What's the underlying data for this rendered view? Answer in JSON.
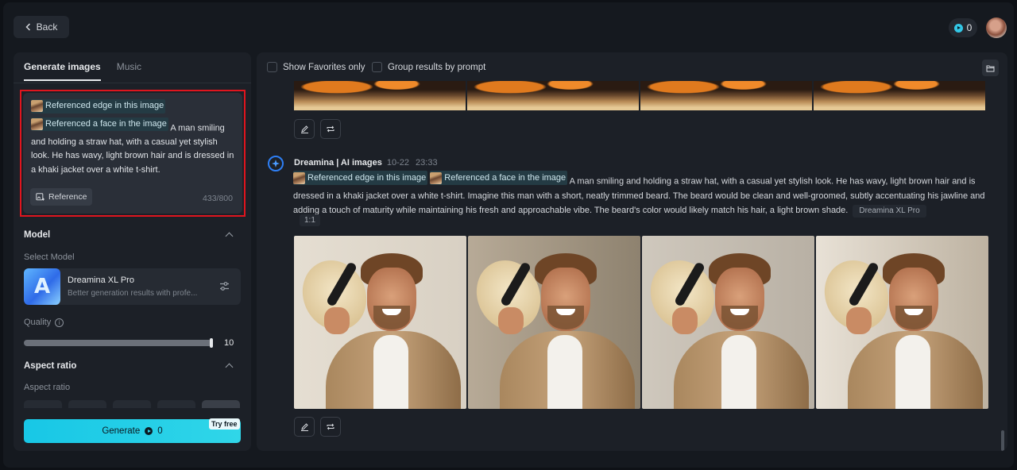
{
  "topbar": {
    "back_label": "Back",
    "credits": "0"
  },
  "left": {
    "tabs": [
      {
        "label": "Generate images",
        "active": true
      },
      {
        "label": "Music",
        "active": false
      }
    ],
    "prompt": {
      "ref1": "Referenced edge in this image",
      "ref2": "Referenced a face in the image",
      "text": "A man smiling and holding a straw hat, with a casual yet stylish look. He has wavy, light brown hair and is dressed in a khaki jacket over a white t-shirt.",
      "reference_label": "Reference",
      "counter": "433/800"
    },
    "model": {
      "section_title": "Model",
      "select_label": "Select Model",
      "name": "Dreamina XL Pro",
      "description": "Better generation results with profe...",
      "logo_letter": "A"
    },
    "quality": {
      "label": "Quality",
      "value": "10",
      "fraction": 1.0
    },
    "aspect": {
      "section_title": "Aspect ratio",
      "label": "Aspect ratio"
    },
    "generate": {
      "label": "Generate",
      "cost": "0",
      "badge": "Try free"
    }
  },
  "right": {
    "options": {
      "favorites": "Show Favorites only",
      "group": "Group results by prompt"
    },
    "generation": {
      "title": "Dreamina | AI images",
      "date": "10-22",
      "time": "23:33",
      "ref1": "Referenced edge in this image",
      "ref2": "Referenced a face in the image",
      "prompt": "A man smiling and holding a straw hat, with a casual yet stylish look. He has wavy, light brown hair and is dressed in a khaki jacket over a white t-shirt. Imagine this man with a short, neatly trimmed beard. The beard would be clean and well-groomed, subtly accentuating his jawline and adding a touch of maturity while maintaining his fresh and approachable vibe. The beard's color would likely match his hair, a light brown shade.",
      "model_tag": "Dreamina XL Pro",
      "ratio_tag": "1:1"
    }
  },
  "colors": {
    "accent": "#18c7e6",
    "highlight_border": "#e0151e",
    "panel": "#1c2027"
  }
}
